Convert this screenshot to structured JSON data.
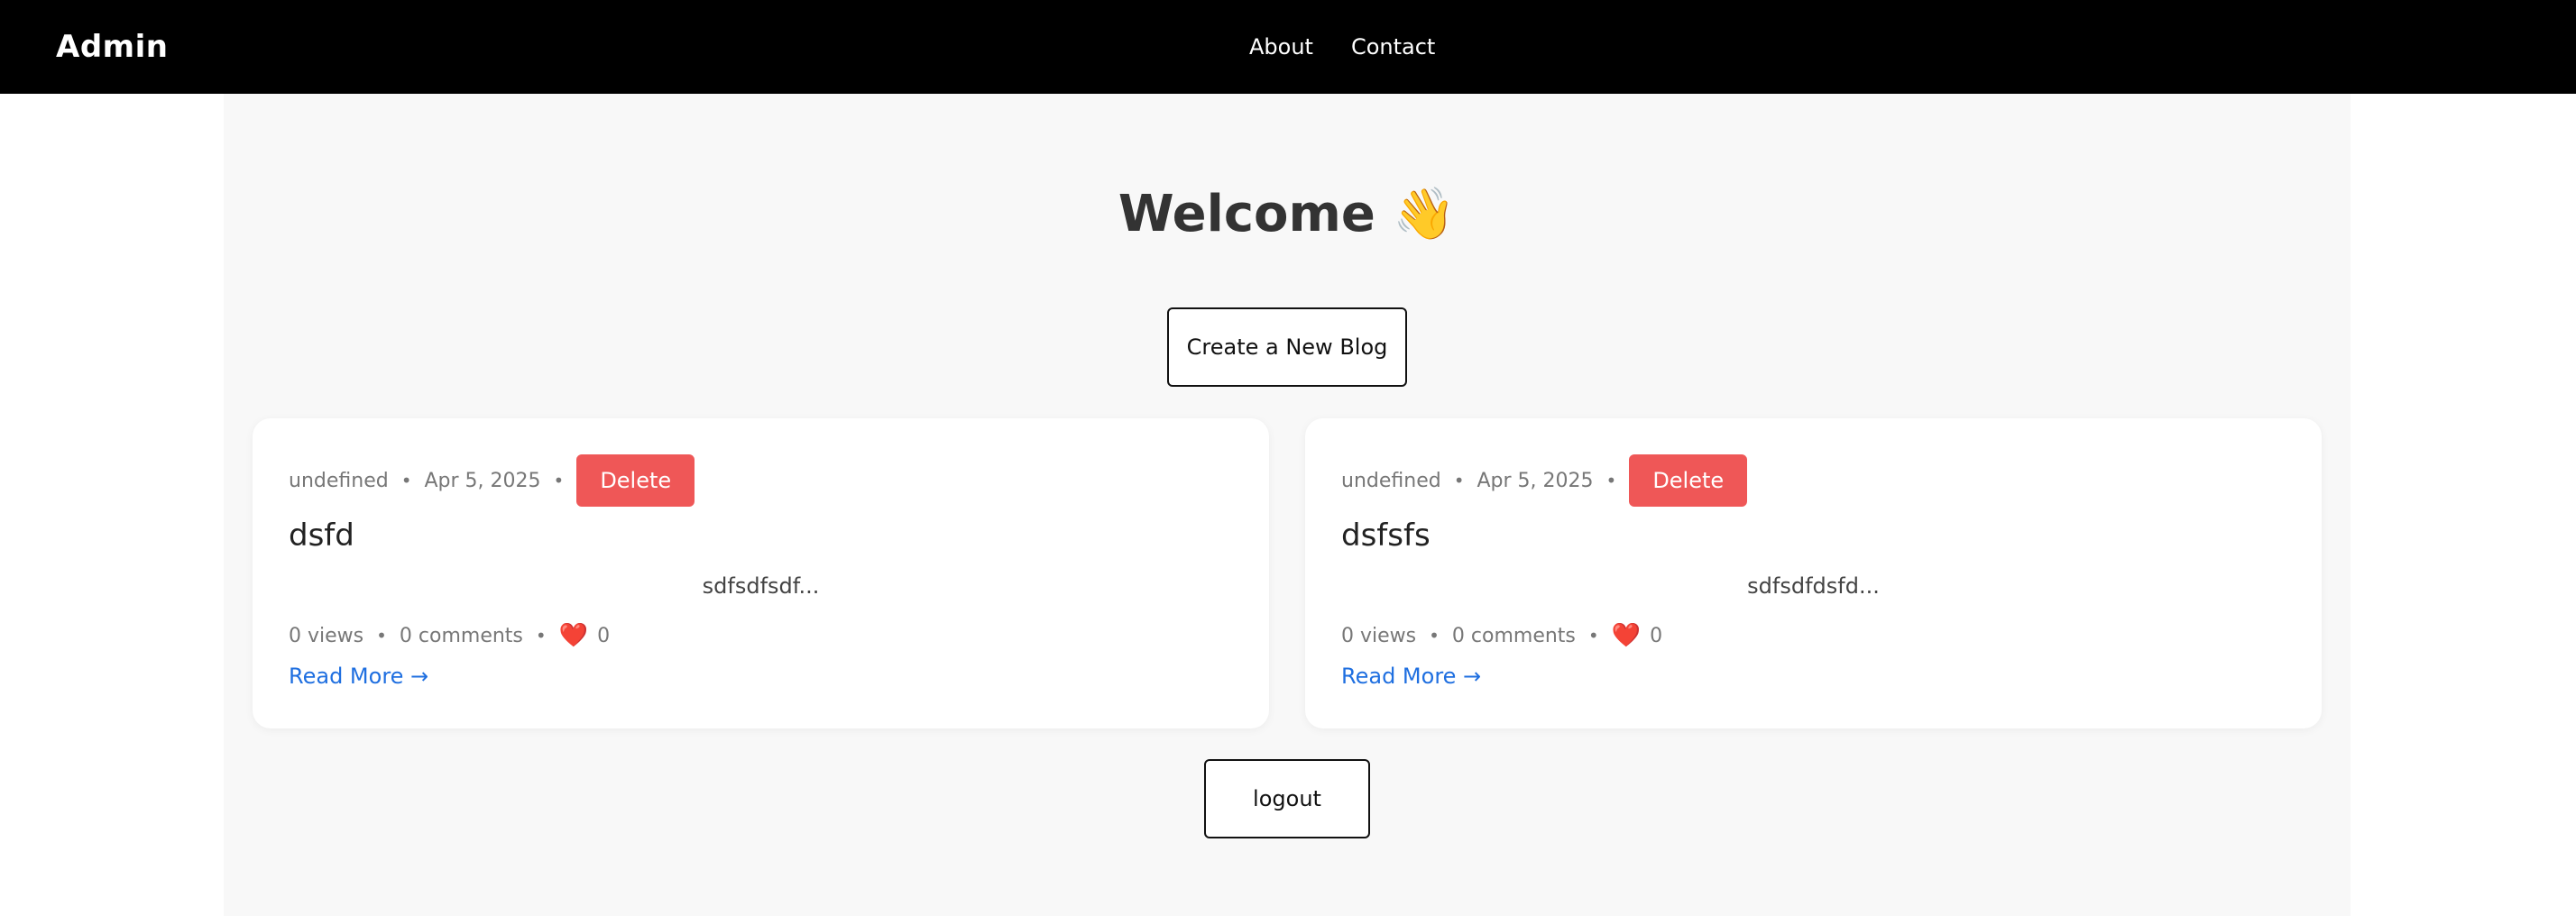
{
  "navbar": {
    "brand": "Admin",
    "links": [
      {
        "label": "About"
      },
      {
        "label": "Contact"
      }
    ],
    "background": "#000000"
  },
  "main": {
    "heading": "Welcome",
    "heading_emoji": "👋",
    "create_button": "Create a New Blog",
    "logout_button": "logout"
  },
  "posts": [
    {
      "author": "undefined",
      "date": "Apr 5, 2025",
      "delete_label": "Delete",
      "title": "dsfd",
      "excerpt": "sdfsdfsdf...",
      "views": "0 views",
      "comments": "0 comments",
      "heart_icon": "❤️",
      "likes": "0",
      "read_more": "Read More →"
    },
    {
      "author": "undefined",
      "date": "Apr 5, 2025",
      "delete_label": "Delete",
      "title": "dsfsfs",
      "excerpt": "sdfsdfdsfd...",
      "views": "0 views",
      "comments": "0 comments",
      "heart_icon": "❤️",
      "likes": "0",
      "read_more": "Read More →"
    }
  ],
  "colors": {
    "delete": "#ef5757",
    "link": "#1f6fe0",
    "content_bg": "#f8f8f8"
  }
}
